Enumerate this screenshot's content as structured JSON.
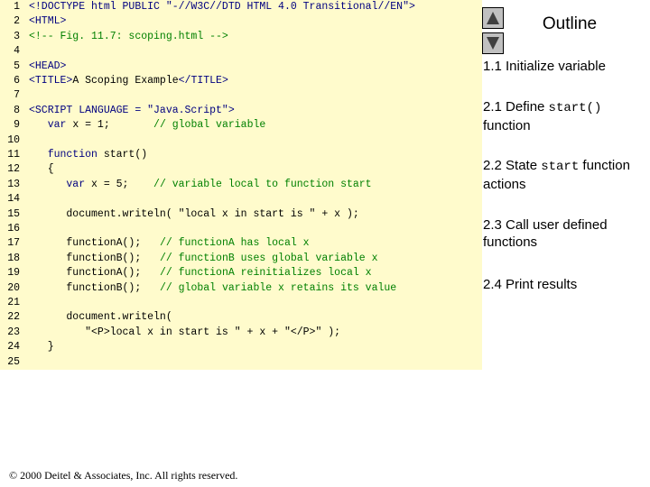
{
  "outline": {
    "title": "Outline",
    "items": [
      {
        "id": "1.1",
        "parts": [
          {
            "text": "1.1 Initialize variable",
            "mono": false
          }
        ]
      },
      {
        "id": "2.1",
        "parts": [
          {
            "text": "2.1 Define ",
            "mono": false
          },
          {
            "text": "start()",
            "mono": true
          },
          {
            "text": " function",
            "mono": false
          }
        ]
      },
      {
        "id": "2.2",
        "parts": [
          {
            "text": "2.2 State ",
            "mono": false
          },
          {
            "text": "start",
            "mono": true
          },
          {
            "text": " function actions",
            "mono": false
          }
        ]
      },
      {
        "id": "2.3",
        "parts": [
          {
            "text": "2.3 Call user defined functions",
            "mono": false
          }
        ]
      },
      {
        "id": "2.4",
        "parts": [
          {
            "text": "2.4 Print results",
            "mono": false
          }
        ]
      }
    ]
  },
  "nav": {
    "up_icon": "triangle-up-icon",
    "down_icon": "triangle-down-icon"
  },
  "colors": {
    "code_background": "#fffbcc",
    "markup": "#000080",
    "comment": "#008000"
  },
  "code_lines": [
    {
      "num": "1",
      "segments": [
        {
          "t": "<!DOCTYPE html PUBLIC \"-//W3C//DTD HTML 4.0 Transitional//EN\">",
          "c": "markup"
        }
      ]
    },
    {
      "num": "2",
      "segments": [
        {
          "t": "<HTML>",
          "c": "markup"
        }
      ]
    },
    {
      "num": "3",
      "segments": [
        {
          "t": "<!-- Fig. 11.7: scoping.html -->",
          "c": "comment"
        }
      ]
    },
    {
      "num": "4",
      "segments": []
    },
    {
      "num": "5",
      "segments": [
        {
          "t": "<HEAD>",
          "c": "markup"
        }
      ]
    },
    {
      "num": "6",
      "segments": [
        {
          "t": "<TITLE>",
          "c": "markup"
        },
        {
          "t": "A Scoping Example",
          "c": "default"
        },
        {
          "t": "</TITLE>",
          "c": "markup"
        }
      ]
    },
    {
      "num": "7",
      "segments": []
    },
    {
      "num": "8",
      "segments": [
        {
          "t": "<SCRIPT LANGUAGE = \"Java.Script\">",
          "c": "markup"
        }
      ]
    },
    {
      "num": "9",
      "segments": [
        {
          "t": "   var",
          "c": "keyword"
        },
        {
          "t": " x = 1;       ",
          "c": "default"
        },
        {
          "t": "// global variable",
          "c": "comment"
        }
      ]
    },
    {
      "num": "10",
      "segments": []
    },
    {
      "num": "11",
      "segments": [
        {
          "t": "   function",
          "c": "keyword"
        },
        {
          "t": " start()",
          "c": "default"
        }
      ]
    },
    {
      "num": "12",
      "segments": [
        {
          "t": "   {",
          "c": "default"
        }
      ]
    },
    {
      "num": "13",
      "segments": [
        {
          "t": "      var",
          "c": "keyword"
        },
        {
          "t": " x = 5;    ",
          "c": "default"
        },
        {
          "t": "// variable local to function start",
          "c": "comment"
        }
      ]
    },
    {
      "num": "14",
      "segments": []
    },
    {
      "num": "15",
      "segments": [
        {
          "t": "      document.writeln( \"local x in start is \" + x );",
          "c": "default"
        }
      ]
    },
    {
      "num": "16",
      "segments": []
    },
    {
      "num": "17",
      "segments": [
        {
          "t": "      functionA();   ",
          "c": "default"
        },
        {
          "t": "// functionA has local x",
          "c": "comment"
        }
      ]
    },
    {
      "num": "18",
      "segments": [
        {
          "t": "      functionB();   ",
          "c": "default"
        },
        {
          "t": "// functionB uses global variable x",
          "c": "comment"
        }
      ]
    },
    {
      "num": "19",
      "segments": [
        {
          "t": "      functionA();   ",
          "c": "default"
        },
        {
          "t": "// functionA reinitializes local x",
          "c": "comment"
        }
      ]
    },
    {
      "num": "20",
      "segments": [
        {
          "t": "      functionB();   ",
          "c": "default"
        },
        {
          "t": "// global variable x retains its value",
          "c": "comment"
        }
      ]
    },
    {
      "num": "21",
      "segments": []
    },
    {
      "num": "22",
      "segments": [
        {
          "t": "      document.writeln(",
          "c": "default"
        }
      ]
    },
    {
      "num": "23",
      "segments": [
        {
          "t": "         \"<P>local x in start is \" + x + \"</P>\" );",
          "c": "default"
        }
      ]
    },
    {
      "num": "24",
      "segments": [
        {
          "t": "   }",
          "c": "default"
        }
      ]
    },
    {
      "num": "25",
      "segments": []
    }
  ],
  "footer": {
    "copyright": "© 2000 Deitel & Associates, Inc. All rights reserved."
  }
}
